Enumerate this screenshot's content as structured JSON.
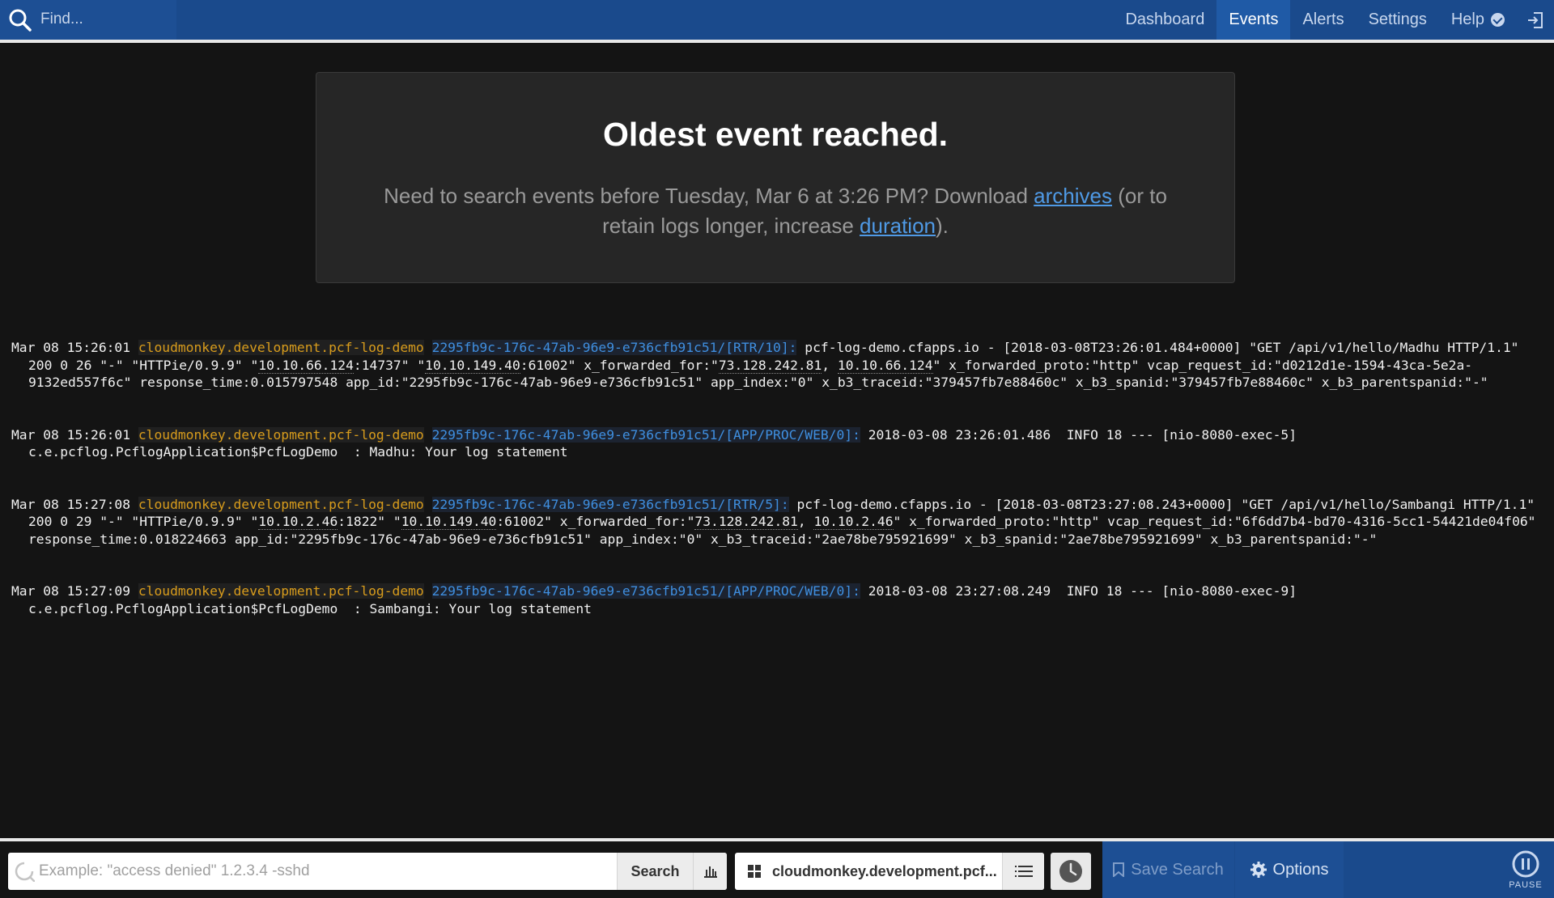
{
  "topbar": {
    "find_placeholder": "Find...",
    "nav": {
      "dashboard": "Dashboard",
      "events": "Events",
      "alerts": "Alerts",
      "settings": "Settings",
      "help": "Help"
    }
  },
  "notice": {
    "title": "Oldest event reached.",
    "text_before": "Need to search events before Tuesday, Mar 6 at 3:26 PM? Download ",
    "archives_link": "archives",
    "text_middle": " (or to retain logs longer, increase ",
    "duration_link": "duration",
    "text_after": ")."
  },
  "events": [
    {
      "time": "Mar 08 15:26:01",
      "source": "cloudmonkey.development.pcf-log-demo",
      "program": "2295fb9c-176c-47ab-96e9-e736cfb91c51/[RTR/10]:",
      "msg_a": "pcf-log-demo.cfapps.io - [2018-03-08T23:26:01.484+0000] \"GET /api/v1/hello/Madhu HTTP/1.1\" 200 0 26 \"-\" \"HTTPie/0.9.9\" \"",
      "ip1": "10.10.66.124",
      "msg_b": ":14737\" \"",
      "ip2": "10.10.149.40",
      "msg_c": ":61002\" x_forwarded_for:\"",
      "ip3": "73.128.242.81",
      "msg_d": ", ",
      "ip4": "10.10.66.124",
      "msg_e": "\" x_forwarded_proto:\"http\" vcap_request_id:\"d0212d1e-1594-43ca-5e2a-9132ed557f6c\" response_time:0.015797548 app_id:\"2295fb9c-176c-47ab-96e9-e736cfb91c51\" app_index:\"0\" x_b3_traceid:\"379457fb7e88460c\" x_b3_spanid:\"379457fb7e88460c\" x_b3_parentspanid:\"-\""
    },
    {
      "time": "Mar 08 15:26:01",
      "source": "cloudmonkey.development.pcf-log-demo",
      "program": "2295fb9c-176c-47ab-96e9-e736cfb91c51/[APP/PROC/WEB/0]:",
      "message": "2018-03-08 23:26:01.486  INFO 18 --- [nio-8080-exec-5] c.e.pcflog.PcflogApplication$PcfLogDemo  : Madhu: Your log statement"
    },
    {
      "time": "Mar 08 15:27:08",
      "source": "cloudmonkey.development.pcf-log-demo",
      "program": "2295fb9c-176c-47ab-96e9-e736cfb91c51/[RTR/5]:",
      "msg_a": "pcf-log-demo.cfapps.io - [2018-03-08T23:27:08.243+0000] \"GET /api/v1/hello/Sambangi HTTP/1.1\" 200 0 29 \"-\" \"HTTPie/0.9.9\" \"",
      "ip1": "10.10.2.46",
      "msg_b": ":1822\" \"",
      "ip2": "10.10.149.40",
      "msg_c": ":61002\" x_forwarded_for:\"",
      "ip3": "73.128.242.81",
      "msg_d": ", ",
      "ip4": "10.10.2.46",
      "msg_e": "\" x_forwarded_proto:\"http\" vcap_request_id:\"6f6dd7b4-bd70-4316-5cc1-54421de04f06\" response_time:0.018224663 app_id:\"2295fb9c-176c-47ab-96e9-e736cfb91c51\" app_index:\"0\" x_b3_traceid:\"2ae78be795921699\" x_b3_spanid:\"2ae78be795921699\" x_b3_parentspanid:\"-\""
    },
    {
      "time": "Mar 08 15:27:09",
      "source": "cloudmonkey.development.pcf-log-demo",
      "program": "2295fb9c-176c-47ab-96e9-e736cfb91c51/[APP/PROC/WEB/0]:",
      "message": "2018-03-08 23:27:08.249  INFO 18 --- [nio-8080-exec-9] c.e.pcflog.PcflogApplication$PcfLogDemo  : Sambangi: Your log statement"
    }
  ],
  "bottombar": {
    "search_placeholder": "Example: \"access denied\" 1.2.3.4 -sshd",
    "search_label": "Search",
    "group_label": "cloudmonkey.development.pcf...",
    "save_search_label": "Save Search",
    "options_label": "Options",
    "pause_label": "PAUSE"
  },
  "colors": {
    "topbar_blue": "#1a4a8c",
    "source_orange": "#d89c1c",
    "program_blue": "#3f8fe0",
    "link_blue": "#4f9ae6"
  }
}
